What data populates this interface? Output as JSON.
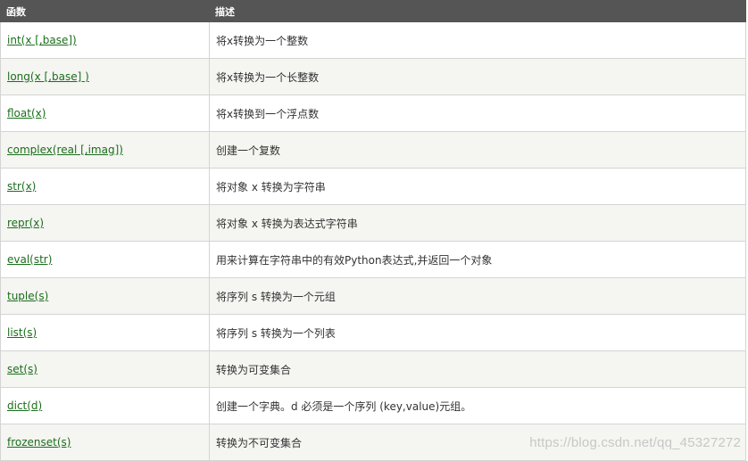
{
  "table": {
    "headers": [
      "函数",
      "描述"
    ],
    "rows": [
      {
        "func": "int(x [,base])",
        "desc": "将x转换为一个整数"
      },
      {
        "func": "long(x [,base] )",
        "desc": "将x转换为一个长整数"
      },
      {
        "func": "float(x)",
        "desc": "将x转换到一个浮点数"
      },
      {
        "func": "complex(real [,imag])",
        "desc": "创建一个复数"
      },
      {
        "func": "str(x)",
        "desc": "将对象 x 转换为字符串"
      },
      {
        "func": "repr(x)",
        "desc": "将对象 x 转换为表达式字符串"
      },
      {
        "func": "eval(str)",
        "desc": "用来计算在字符串中的有效Python表达式,并返回一个对象"
      },
      {
        "func": "tuple(s)",
        "desc": "将序列 s 转换为一个元组"
      },
      {
        "func": "list(s)",
        "desc": "将序列 s 转换为一个列表"
      },
      {
        "func": "set(s)",
        "desc": "转换为可变集合"
      },
      {
        "func": "dict(d)",
        "desc": "创建一个字典。d 必须是一个序列 (key,value)元组。"
      },
      {
        "func": "frozenset(s)",
        "desc": "转换为不可变集合"
      }
    ]
  },
  "watermark": "https://blog.csdn.net/qq_45327272",
  "colors": {
    "header_bg": "#555555",
    "link": "#1a6e1a",
    "stripe": "#f5f5f2"
  }
}
